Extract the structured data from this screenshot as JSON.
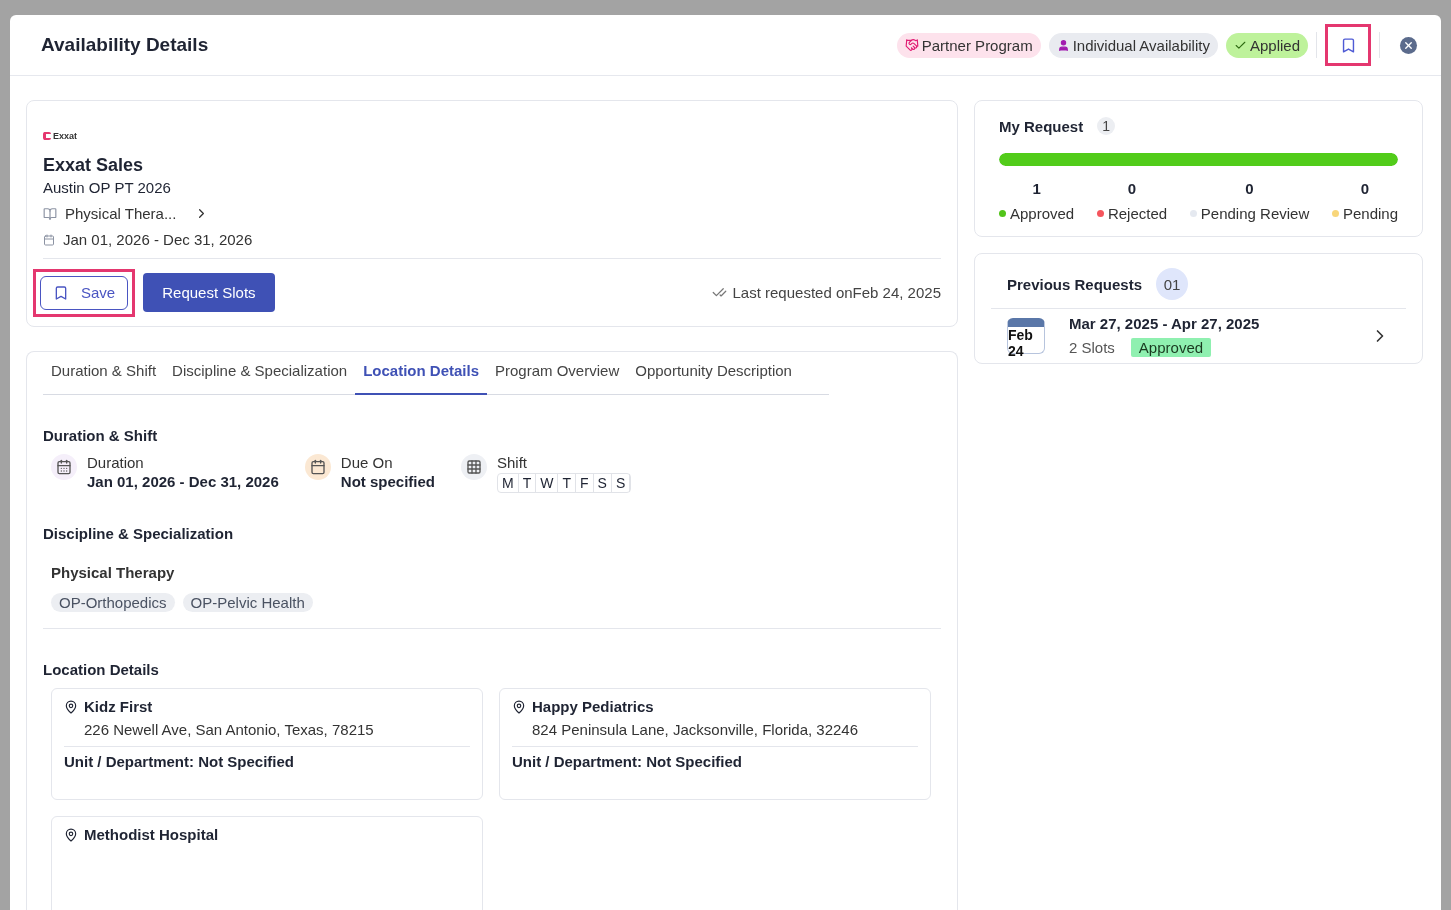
{
  "header": {
    "title": "Availability Details",
    "tags": [
      {
        "kind": "partner",
        "label": "Partner Program"
      },
      {
        "kind": "person",
        "label": "Individual Availability"
      },
      {
        "kind": "applied",
        "label": "Applied"
      }
    ],
    "bookmark_highlighted": true
  },
  "summary": {
    "logo": "Exxat",
    "name": "Exxat Sales",
    "program": "Austin OP PT 2026",
    "discipline": "Physical Thera...",
    "dates": "Jan 01, 2026 - Dec 31, 2026",
    "save_label": "Save",
    "save_highlighted": true,
    "request_label": "Request Slots",
    "last_requested": "Last requested onFeb 24, 2025"
  },
  "tabs": [
    {
      "label": "Duration & Shift",
      "selected": false
    },
    {
      "label": "Discipline & Specialization",
      "selected": false
    },
    {
      "label": "Location Details",
      "selected": true
    },
    {
      "label": "Program Overview",
      "selected": false
    },
    {
      "label": "Opportunity Description",
      "selected": false
    }
  ],
  "duration_shift": {
    "heading": "Duration & Shift",
    "duration_label": "Duration",
    "duration_value": "Jan 01, 2026 - Dec 31, 2026",
    "due_label": "Due On",
    "due_value": "Not specified",
    "shift_label": "Shift",
    "days": [
      "M",
      "T",
      "W",
      "T",
      "F",
      "S",
      "S"
    ]
  },
  "discipline": {
    "heading": "Discipline & Specialization",
    "name": "Physical Therapy",
    "specializations": [
      "OP-Orthopedics",
      "OP-Pelvic Health"
    ]
  },
  "locations": {
    "heading": "Location Details",
    "items": [
      {
        "name": "Kidz First",
        "address": "226 Newell Ave, San Antonio, Texas, 78215",
        "unit": "Unit / Department: Not Specified"
      },
      {
        "name": "Happy Pediatrics",
        "address": "824 Peninsula Lane, Jacksonville, Florida, 32246",
        "unit": "Unit / Department: Not Specified"
      },
      {
        "name": "Methodist Hospital"
      }
    ]
  },
  "my_request": {
    "title": "My Request",
    "count": "1",
    "level": 1,
    "stats": [
      {
        "value": "1",
        "label": "Approved",
        "color": "#52c41a"
      },
      {
        "value": "0",
        "label": "Rejected",
        "color": "#f5555d"
      },
      {
        "value": "0",
        "label": "Pending Review",
        "color": "#e5e9f0"
      },
      {
        "value": "0",
        "label": "Pending",
        "color": "#f8d67a"
      }
    ]
  },
  "previous_requests": {
    "title": "Previous Requests",
    "count": "01",
    "items": [
      {
        "month": "Feb",
        "day": "24",
        "dates": "Mar 27, 2025 - Apr 27, 2025",
        "slots": "2 Slots",
        "status": "Approved"
      }
    ]
  }
}
